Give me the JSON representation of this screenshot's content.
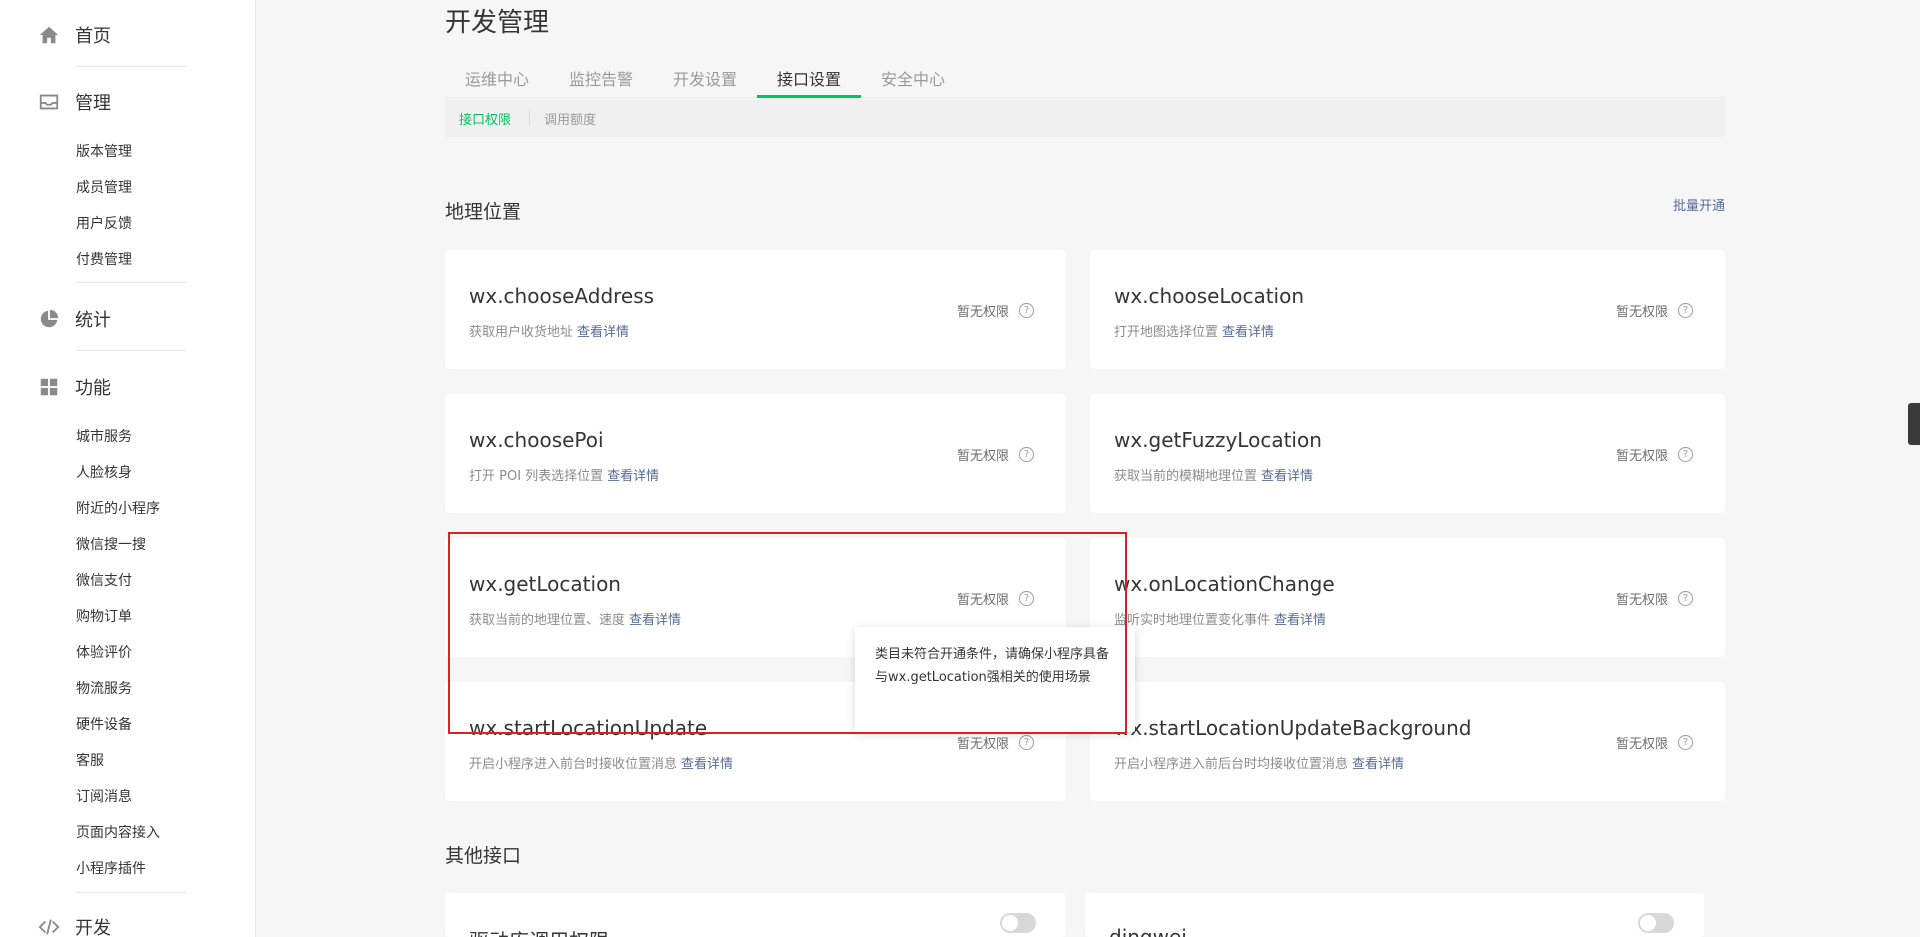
{
  "sidebar": {
    "home": "首页",
    "manage": "管理",
    "manage_items": [
      "版本管理",
      "成员管理",
      "用户反馈",
      "付费管理"
    ],
    "stats": "统计",
    "features": "功能",
    "feature_items": [
      "城市服务",
      "人脸核身",
      "附近的小程序",
      "微信搜一搜",
      "微信支付",
      "购物订单",
      "体验评价",
      "物流服务",
      "硬件设备",
      "客服",
      "订阅消息",
      "页面内容接入",
      "小程序插件"
    ],
    "dev": "开发"
  },
  "page_title": "开发管理",
  "tabs": [
    "运维中心",
    "监控告警",
    "开发设置",
    "接口设置",
    "安全中心"
  ],
  "active_tab": "接口设置",
  "subtabs": [
    "接口权限",
    "调用额度"
  ],
  "section_geo": "地理位置",
  "batch_open": "批量开通",
  "link_text": "查看详情",
  "status_text": "暂无权限",
  "cards": [
    {
      "name": "wx.chooseAddress",
      "desc": "获取用户收货地址"
    },
    {
      "name": "wx.chooseLocation",
      "desc": "打开地图选择位置"
    },
    {
      "name": "wx.choosePoi",
      "desc": "打开 POI 列表选择位置"
    },
    {
      "name": "wx.getFuzzyLocation",
      "desc": "获取当前的模糊地理位置"
    },
    {
      "name": "wx.getLocation",
      "desc": "获取当前的地理位置、速度"
    },
    {
      "name": "wx.onLocationChange",
      "desc": "监听实时地理位置变化事件"
    },
    {
      "name": "wx.startLocationUpdate",
      "desc": "开启小程序进入前台时接收位置消息"
    },
    {
      "name": "wx.startLocationUpdateBackground",
      "desc": "开启小程序进入前后台时均接收位置消息"
    }
  ],
  "tooltip": "类目未符合开通条件，请确保小程序具备与wx.getLocation强相关的使用场景",
  "section_other": "其他接口",
  "other_cards": [
    {
      "name": "驱动库调用权限"
    },
    {
      "name": "dingwei"
    }
  ]
}
